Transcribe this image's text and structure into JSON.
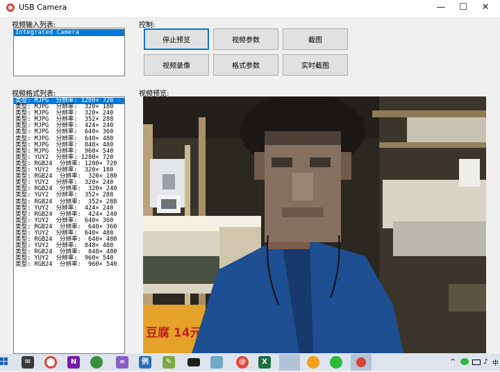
{
  "window": {
    "title": "USB Camera",
    "minimize_glyph": "—",
    "maximize_glyph": "☐",
    "close_glyph": "✕"
  },
  "input_list": {
    "label": "视频输入列表:",
    "items": [
      "Integrated Camera"
    ]
  },
  "control": {
    "label": "控制:",
    "buttons": [
      "停止预览",
      "视频参数",
      "截图",
      "视频录像",
      "格式参数",
      "实时截图"
    ]
  },
  "format_list": {
    "label": "视频格式列表:",
    "items": [
      "类型: MJPG  分辨率: 1280× 720",
      "类型: MJPG  分辨率:  320× 180",
      "类型: MJPG  分辨率:  320× 240",
      "类型: MJPG  分辨率:  352× 288",
      "类型: MJPG  分辨率:  424× 240",
      "类型: MJPG  分辨率:  640× 360",
      "类型: MJPG  分辨率:  640× 480",
      "类型: MJPG  分辨率:  848× 480",
      "类型: MJPG  分辨率:  960× 540",
      "类型: YUY2  分辨率: 1280× 720",
      "类型: RGB24  分辨率: 1280× 720",
      "类型: YUY2  分辨率:  320× 180",
      "类型: RGB24  分辨率:  320× 180",
      "类型: YUY2  分辨率:  320× 240",
      "类型: RGB24  分辨率:  320× 240",
      "类型: YUY2  分辨率:  352× 288",
      "类型: RGB24  分辨率:  352× 288",
      "类型: YUY2  分辨率:  424× 240",
      "类型: RGB24  分辨率:  424× 240",
      "类型: YUY2  分辨率:  640× 360",
      "类型: RGB24  分辨率:  640× 360",
      "类型: YUY2  分辨率:  640× 480",
      "类型: RGB24  分辨率:  640× 480",
      "类型: YUY2  分辨率:  848× 480",
      "类型: RGB24  分辨率:  848× 480",
      "类型: YUY2  分辨率:  960× 540",
      "类型: RGB24  分辨率:  960× 540"
    ]
  },
  "preview": {
    "label": "视频预览:",
    "sign_text": "豆腐 14元/"
  },
  "taskbar": {
    "icons": [
      "windows-start",
      "mail",
      "chrome",
      "onenote",
      "green-app",
      "visual-studio",
      "example-app",
      "notepad",
      "terminal",
      "files",
      "swirl-app",
      "excel",
      "camera-app",
      "color-app",
      "wechat",
      "usb-camera"
    ],
    "tray_glyph": "^",
    "volume_glyph": "♪"
  },
  "colors": {
    "selection": "#0078d7",
    "window_bg": "#f0f0f0",
    "taskbar_bg": "#dde4ee"
  }
}
